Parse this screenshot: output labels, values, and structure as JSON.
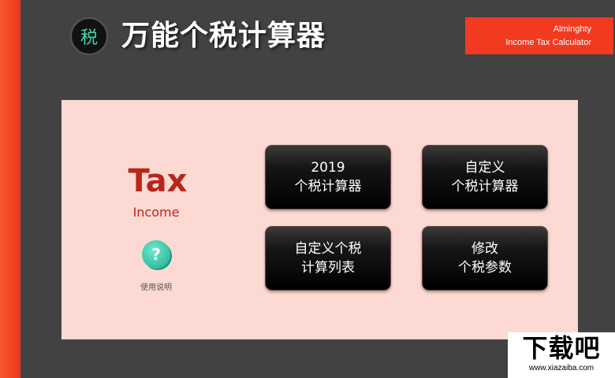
{
  "header": {
    "logo_char": "税",
    "title": "万能个税计算器",
    "en_title_line1": "Alminghty",
    "en_title_line2": "Income Tax Calculator"
  },
  "panel": {
    "tax_word": "Tax",
    "income_word": "Income",
    "help_symbol": "?",
    "help_label": "使用说明",
    "buttons": [
      {
        "line1": "2019",
        "line2": "个税计算器"
      },
      {
        "line1": "自定义",
        "line2": "个税计算器"
      },
      {
        "line1": "自定义个税",
        "line2": "计算列表"
      },
      {
        "line1": "修改",
        "line2": "个税参数"
      }
    ]
  },
  "watermark": {
    "main": "下载吧",
    "sub": "www.xiazaiba.com"
  },
  "colors": {
    "background": "#424242",
    "accent": "#f13a20",
    "panel": "#fdd9d3",
    "tax_red": "#b8261b",
    "help_teal": "#2ec4a1"
  }
}
